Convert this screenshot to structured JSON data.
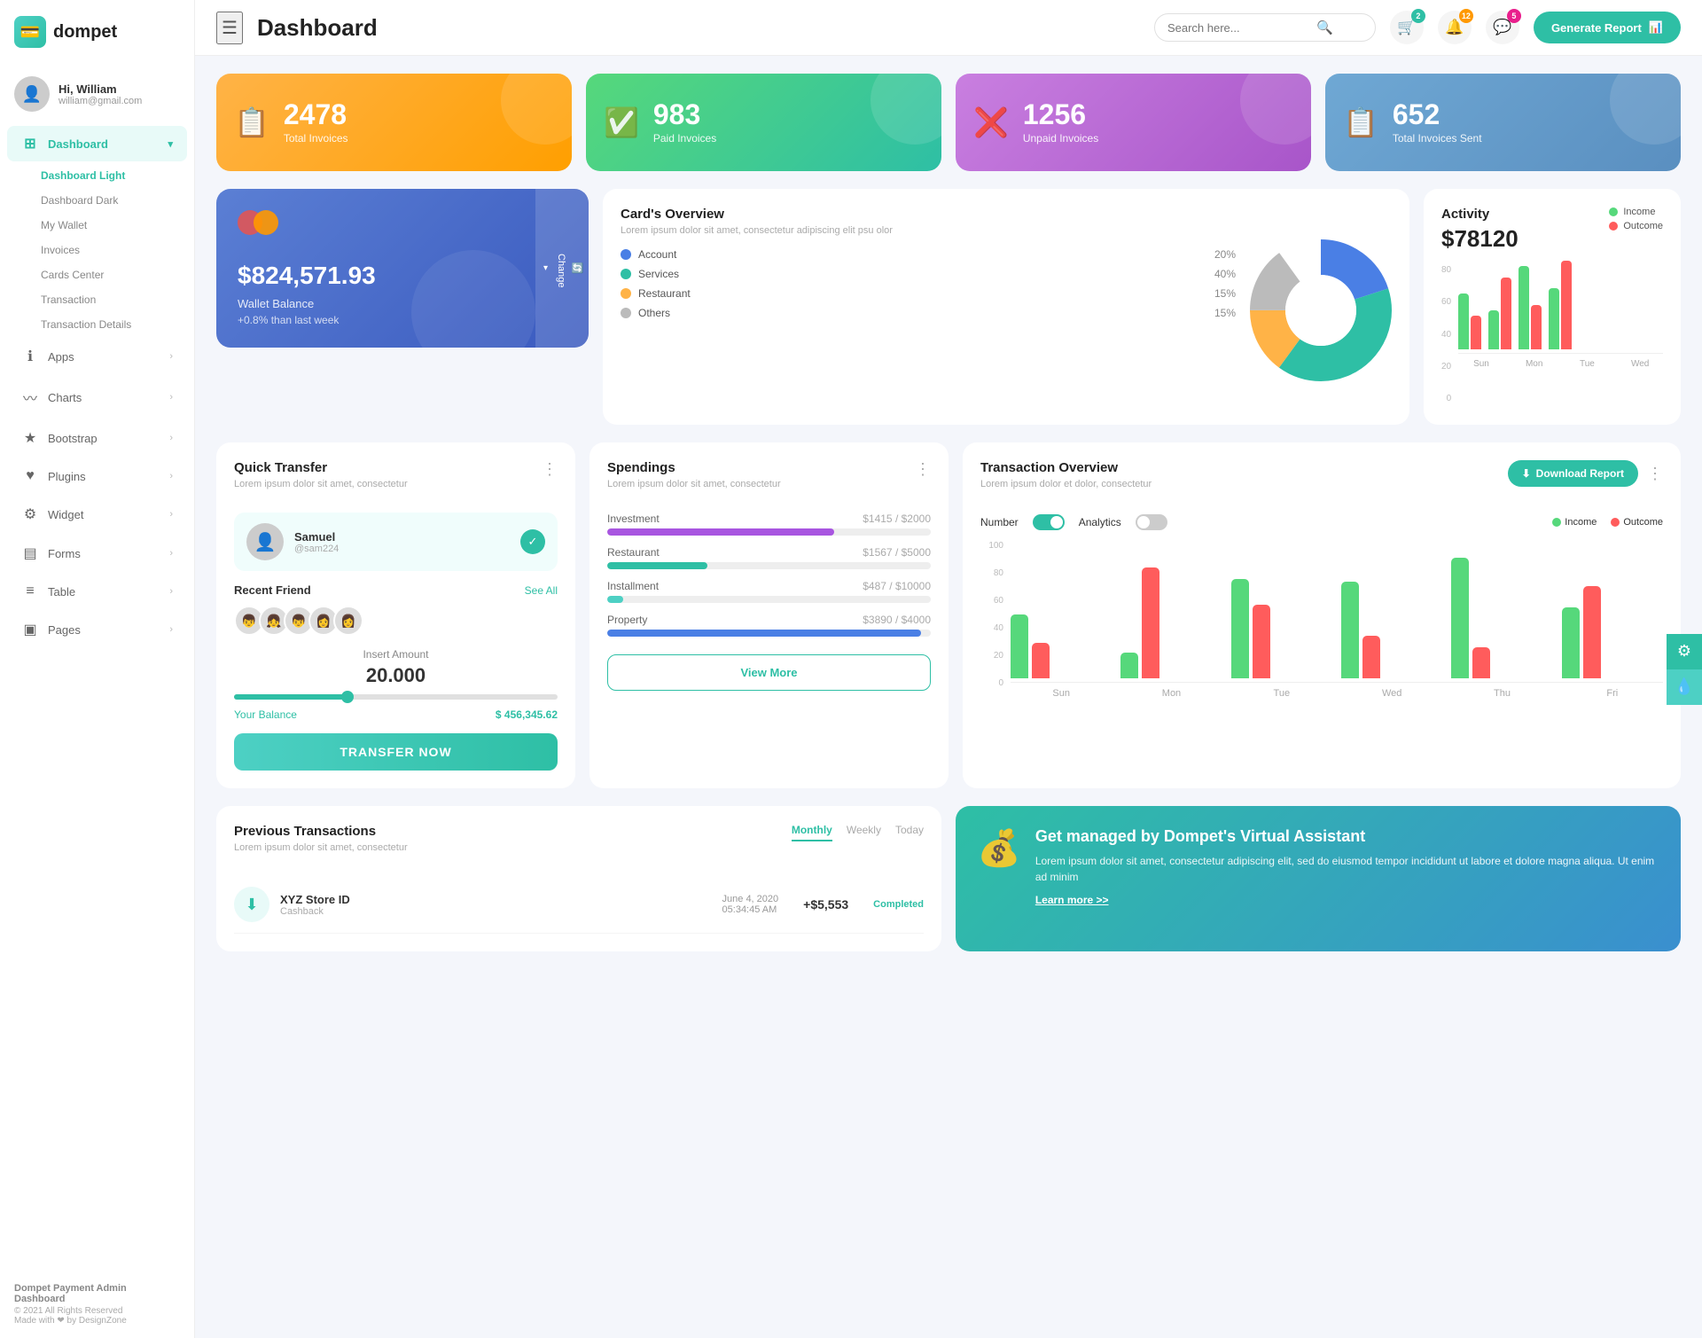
{
  "app": {
    "logo_text": "dompet",
    "title": "Dashboard"
  },
  "sidebar": {
    "user": {
      "greeting": "Hi, William",
      "email": "william@gmail.com"
    },
    "nav": [
      {
        "id": "dashboard",
        "label": "Dashboard",
        "icon": "⊞",
        "active": true,
        "has_arrow_down": true
      },
      {
        "id": "apps",
        "label": "Apps",
        "icon": "ℹ",
        "active": false,
        "has_arrow": true
      },
      {
        "id": "charts",
        "label": "Charts",
        "icon": "∿",
        "active": false,
        "has_arrow": true
      },
      {
        "id": "bootstrap",
        "label": "Bootstrap",
        "icon": "★",
        "active": false,
        "has_arrow": true
      },
      {
        "id": "plugins",
        "label": "Plugins",
        "icon": "♥",
        "active": false,
        "has_arrow": true
      },
      {
        "id": "widget",
        "label": "Widget",
        "icon": "⚙",
        "active": false,
        "has_arrow": true
      },
      {
        "id": "forms",
        "label": "Forms",
        "icon": "▤",
        "active": false,
        "has_arrow": true
      },
      {
        "id": "table",
        "label": "Table",
        "icon": "≡",
        "active": false,
        "has_arrow": true
      },
      {
        "id": "pages",
        "label": "Pages",
        "icon": "▣",
        "active": false,
        "has_arrow": true
      }
    ],
    "sub_items": [
      {
        "label": "Dashboard Light",
        "active": true
      },
      {
        "label": "Dashboard Dark",
        "active": false
      },
      {
        "label": "My Wallet",
        "active": false
      },
      {
        "label": "Invoices",
        "active": false
      },
      {
        "label": "Cards Center",
        "active": false
      },
      {
        "label": "Transaction",
        "active": false
      },
      {
        "label": "Transaction Details",
        "active": false
      }
    ],
    "footer": {
      "title": "Dompet Payment Admin Dashboard",
      "copy": "© 2021 All Rights Reserved",
      "made_with": "Made with ❤ by DesignZone"
    }
  },
  "header": {
    "search_placeholder": "Search here...",
    "badges": {
      "cart": "2",
      "bell": "12",
      "message": "5"
    },
    "generate_btn": "Generate Report"
  },
  "stats": [
    {
      "number": "2478",
      "label": "Total Invoices",
      "icon": "📋",
      "color": "orange"
    },
    {
      "number": "983",
      "label": "Paid Invoices",
      "icon": "✓",
      "color": "green"
    },
    {
      "number": "1256",
      "label": "Unpaid Invoices",
      "icon": "✕",
      "color": "purple"
    },
    {
      "number": "652",
      "label": "Total Invoices Sent",
      "icon": "📋",
      "color": "blue"
    }
  ],
  "wallet": {
    "card_number_hint": "",
    "amount": "$824,571.93",
    "label": "Wallet Balance",
    "growth": "+0.8% than last week",
    "change_btn": "Change"
  },
  "cards_overview": {
    "title": "Card's Overview",
    "subtitle": "Lorem ipsum dolor sit amet, consectetur adipiscing elit psu olor",
    "items": [
      {
        "label": "Account",
        "pct": "20%",
        "color": "#4a7fe5"
      },
      {
        "label": "Services",
        "pct": "40%",
        "color": "#2ebfa5"
      },
      {
        "label": "Restaurant",
        "pct": "15%",
        "color": "#ffb347"
      },
      {
        "label": "Others",
        "pct": "15%",
        "color": "#ccc"
      }
    ]
  },
  "activity": {
    "title": "Activity",
    "amount": "$78120",
    "legend": [
      {
        "label": "Income",
        "color": "#56d87b"
      },
      {
        "label": "Outcome",
        "color": "#ff5c5c"
      }
    ],
    "chart": {
      "labels": [
        "Sun",
        "Mon",
        "Tue",
        "Wed"
      ],
      "income": [
        50,
        35,
        75,
        55
      ],
      "outcome": [
        30,
        65,
        40,
        80
      ]
    },
    "y_labels": [
      "80",
      "60",
      "40",
      "20",
      "0"
    ]
  },
  "quick_transfer": {
    "title": "Quick Transfer",
    "subtitle": "Lorem ipsum dolor sit amet, consectetur",
    "contact": {
      "name": "Samuel",
      "id": "@sam224",
      "avatar_char": "👤"
    },
    "recent_friend_label": "Recent Friend",
    "see_all": "See All",
    "amount_label": "Insert Amount",
    "amount_value": "20.000",
    "balance_label": "Your Balance",
    "balance_amount": "$ 456,345.62",
    "transfer_btn": "TRANSFER NOW"
  },
  "spendings": {
    "title": "Spendings",
    "subtitle": "Lorem ipsum dolor sit amet, consectetur",
    "items": [
      {
        "label": "Investment",
        "current": "$1415",
        "total": "$2000",
        "pct": 70,
        "color": "#a855e0"
      },
      {
        "label": "Restaurant",
        "current": "$1567",
        "total": "$5000",
        "pct": 31,
        "color": "#2ebfa5"
      },
      {
        "label": "Installment",
        "current": "$487",
        "total": "$10000",
        "pct": 5,
        "color": "#4dd0c4"
      },
      {
        "label": "Property",
        "current": "$3890",
        "total": "$4000",
        "pct": 97,
        "color": "#4a7fe5"
      }
    ],
    "view_more": "View More"
  },
  "transaction_overview": {
    "title": "Transaction Overview",
    "subtitle": "Lorem ipsum dolor et dolor, consectetur",
    "download_btn": "Download Report",
    "toggle_number": "Number",
    "toggle_analytics": "Analytics",
    "legend": [
      {
        "label": "Income",
        "color": "#56d87b"
      },
      {
        "label": "Outcome",
        "color": "#ff5c5c"
      }
    ],
    "chart": {
      "labels": [
        "Sun",
        "Mon",
        "Tue",
        "Wed",
        "Thu",
        "Fri"
      ],
      "income": [
        45,
        18,
        70,
        68,
        85,
        50
      ],
      "outcome": [
        25,
        78,
        52,
        30,
        22,
        65
      ]
    },
    "y_labels": [
      "100",
      "80",
      "60",
      "40",
      "20",
      "0"
    ]
  },
  "prev_transactions": {
    "title": "Previous Transactions",
    "subtitle": "Lorem ipsum dolor sit amet, consectetur",
    "tabs": [
      "Monthly",
      "Weekly",
      "Today"
    ],
    "active_tab": "Monthly",
    "items": [
      {
        "name": "XYZ Store ID",
        "type": "Cashback",
        "date": "June 4, 2020",
        "time": "05:34:45 AM",
        "amount": "+$5,553",
        "status": "Completed",
        "icon": "⬇"
      }
    ]
  },
  "virtual_assistant": {
    "title": "Get managed by Dompet's Virtual Assistant",
    "text": "Lorem ipsum dolor sit amet, consectetur adipiscing elit, sed do eiusmod tempor incididunt ut labore et dolore magna aliqua. Ut enim ad minim",
    "link": "Learn more >>"
  }
}
